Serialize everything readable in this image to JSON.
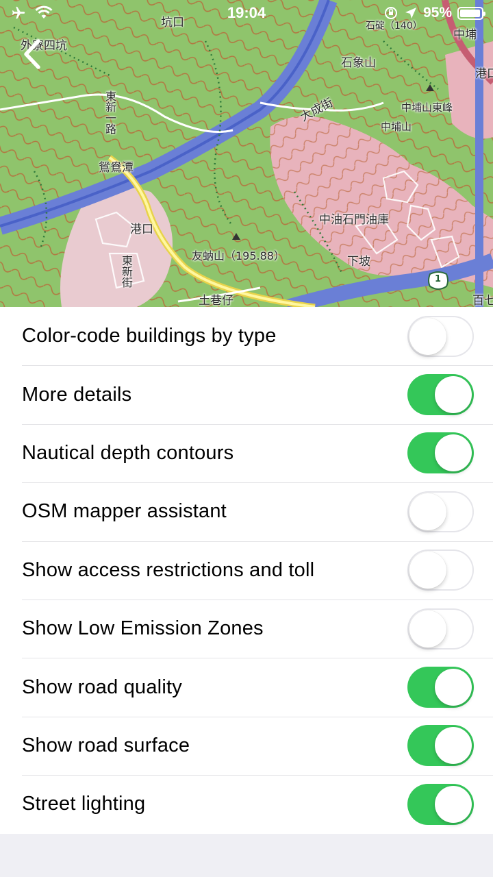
{
  "status_bar": {
    "time": "19:04",
    "battery_percent": "95%",
    "battery_level": 0.95,
    "icons": [
      "airplane-icon",
      "wifi-icon",
      "orientation-lock-icon",
      "location-arrow-icon",
      "battery-icon"
    ]
  },
  "map": {
    "labels": [
      "外寮四坑",
      "坑口",
      "石象山",
      "石碇（140）",
      "中埔",
      "港口",
      "中埔山東峰",
      "中埔山",
      "大成街",
      "東新一路",
      "鴛鴦潭",
      "港口",
      "中油石門油庫",
      "友蚋山（195.88）",
      "下坡",
      "東新街",
      "土巷仔",
      "百七"
    ],
    "road_shield": "1"
  },
  "back_icon": "chevron-left-icon",
  "settings": [
    {
      "label": "Color-code buildings by type",
      "on": false
    },
    {
      "label": "More details",
      "on": true
    },
    {
      "label": "Nautical depth contours",
      "on": true
    },
    {
      "label": "OSM mapper assistant",
      "on": false
    },
    {
      "label": "Show access restrictions and toll",
      "on": false
    },
    {
      "label": "Show Low Emission Zones",
      "on": false
    },
    {
      "label": "Show road quality",
      "on": true
    },
    {
      "label": "Show road surface",
      "on": true
    },
    {
      "label": "Street lighting",
      "on": true
    }
  ],
  "colors": {
    "toggle_on": "#34c759",
    "toggle_off_border": "#e5e5ea",
    "background": "#efeff4"
  }
}
